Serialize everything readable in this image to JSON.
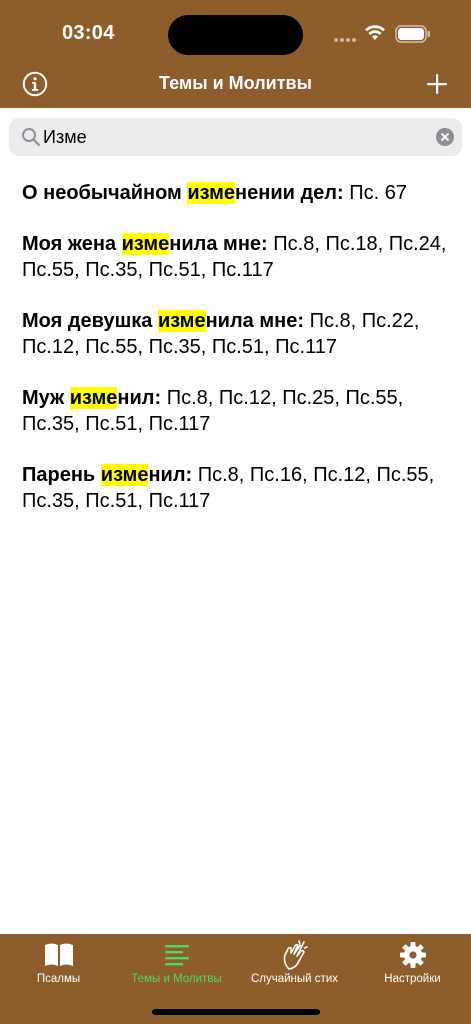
{
  "status_bar": {
    "time": "03:04"
  },
  "header": {
    "title": "Темы и Молитвы"
  },
  "search": {
    "value": "Изме",
    "placeholder": ""
  },
  "results": [
    {
      "pre": "О необычайном ",
      "match": "изме",
      "post": "нении дел:",
      "refs": " Пс. 67"
    },
    {
      "pre": "Моя жена ",
      "match": "изме",
      "post": "нила мне:",
      "refs": " Пс.8, Пс.18, Пс.24, Пс.55, Пс.35, Пс.51, Пс.117"
    },
    {
      "pre": "Моя девушка ",
      "match": "изме",
      "post": "нила мне:",
      "refs": " Пс.8, Пс.22, Пс.12, Пс.55, Пс.35, Пс.51, Пс.117"
    },
    {
      "pre": "Муж ",
      "match": "изме",
      "post": "нил:",
      "refs": " Пс.8, Пс.12, Пс.25, Пс.55, Пс.35, Пс.51, Пс.117"
    },
    {
      "pre": "Парень ",
      "match": "изме",
      "post": "нил:",
      "refs": " Пс.8, Пс.16, Пс.12, Пс.55, Пс.35, Пс.51, Пс.117"
    }
  ],
  "tabs": [
    {
      "label": "Псалмы",
      "icon": "book-icon",
      "active": false
    },
    {
      "label": "Темы и Молитвы",
      "icon": "list-icon",
      "active": true
    },
    {
      "label": "Случайный стих",
      "icon": "clapping-hands-icon",
      "active": false
    },
    {
      "label": "Настройки",
      "icon": "gear-icon",
      "active": false
    }
  ],
  "colors": {
    "bar": "#8e5d2c",
    "highlight": "#ffff00",
    "active_tab": "#4cd964"
  }
}
